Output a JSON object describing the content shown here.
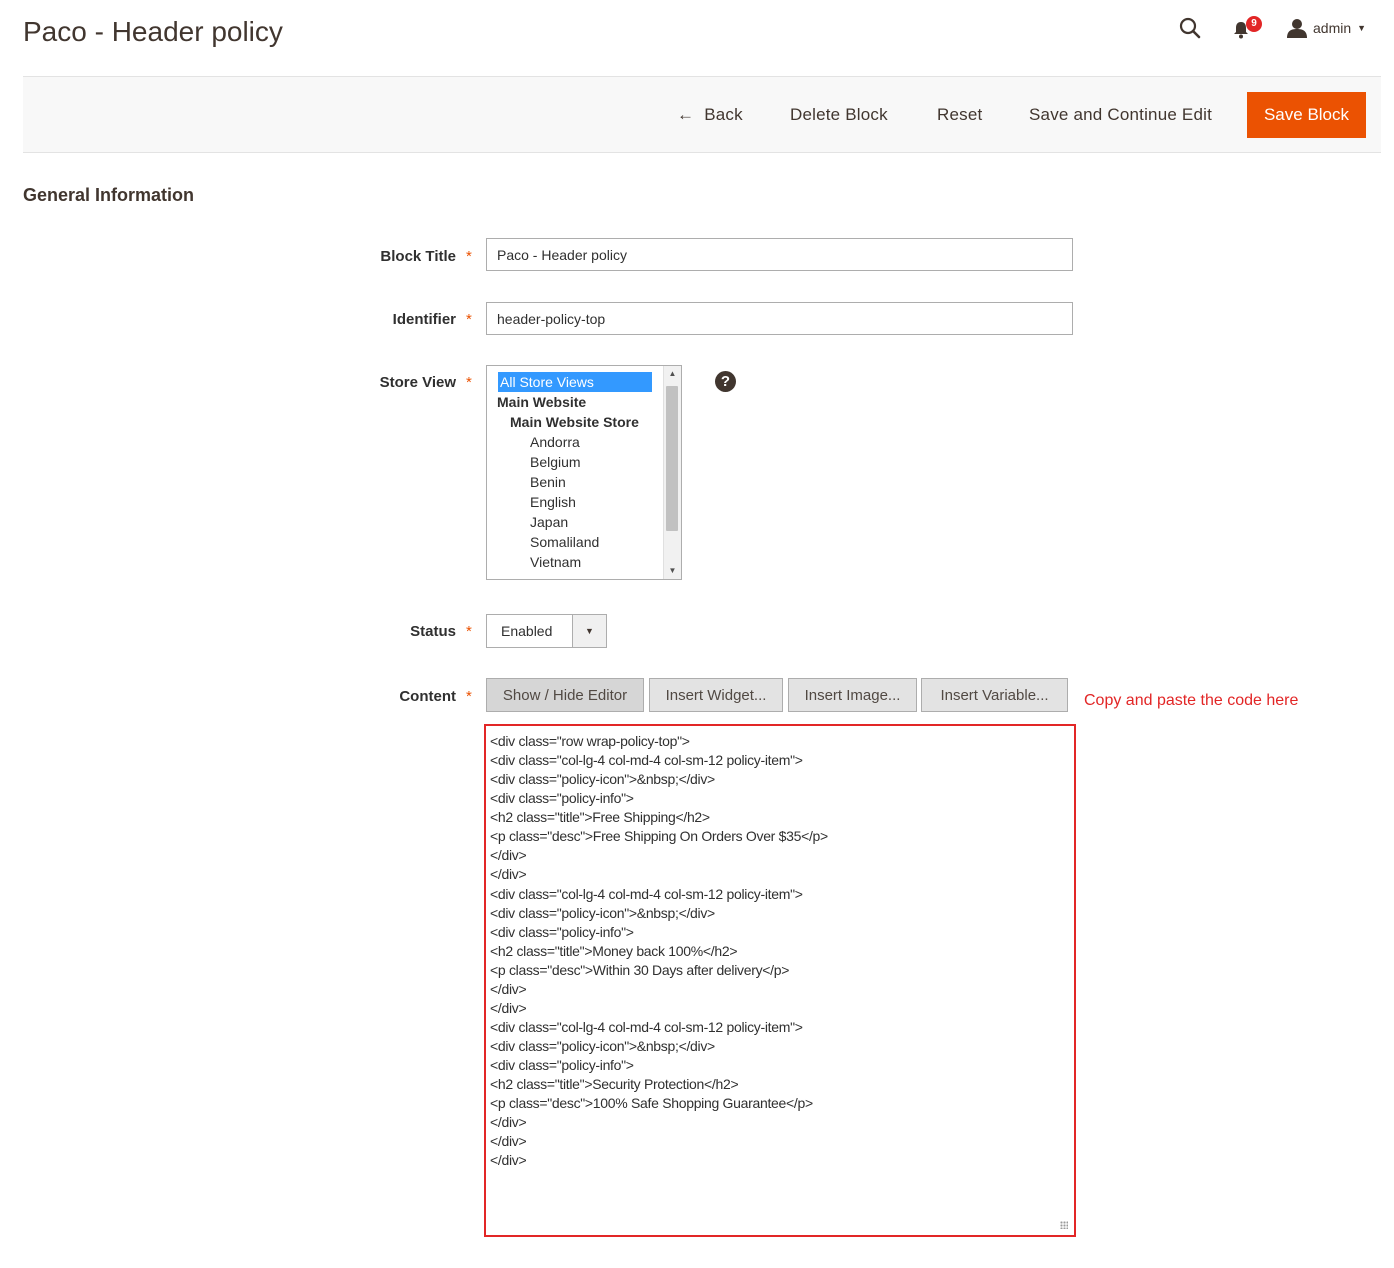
{
  "header": {
    "title": "Paco - Header policy",
    "notification_count": "9",
    "user": "admin"
  },
  "actions": {
    "back": "Back",
    "delete": "Delete Block",
    "reset": "Reset",
    "save_continue": "Save and Continue Edit",
    "save": "Save Block"
  },
  "section_title": "General Information",
  "form": {
    "block_title": {
      "label": "Block Title",
      "value": "Paco - Header policy"
    },
    "identifier": {
      "label": "Identifier",
      "value": "header-policy-top"
    },
    "store_view": {
      "label": "Store View",
      "options": [
        {
          "text": "All Store Views",
          "selected": true,
          "bold": false,
          "indent": 0
        },
        {
          "text": "Main Website",
          "selected": false,
          "bold": true,
          "indent": 0
        },
        {
          "text": "Main Website Store",
          "selected": false,
          "bold": true,
          "indent": 1
        },
        {
          "text": "Andorra",
          "selected": false,
          "bold": false,
          "indent": 2
        },
        {
          "text": "Belgium",
          "selected": false,
          "bold": false,
          "indent": 2
        },
        {
          "text": "Benin",
          "selected": false,
          "bold": false,
          "indent": 2
        },
        {
          "text": "English",
          "selected": false,
          "bold": false,
          "indent": 2
        },
        {
          "text": "Japan",
          "selected": false,
          "bold": false,
          "indent": 2
        },
        {
          "text": "Somaliland",
          "selected": false,
          "bold": false,
          "indent": 2
        },
        {
          "text": "Vietnam",
          "selected": false,
          "bold": false,
          "indent": 2
        }
      ]
    },
    "status": {
      "label": "Status",
      "value": "Enabled"
    },
    "content": {
      "label": "Content",
      "buttons": {
        "toggle": "Show / Hide Editor",
        "widget": "Insert Widget...",
        "image": "Insert Image...",
        "variable": "Insert Variable..."
      },
      "annotation": "Copy and paste the code here",
      "lines": [
        "<div class=\"row wrap-policy-top\">",
        "<div class=\"col-lg-4 col-md-4 col-sm-12 policy-item\">",
        "<div class=\"policy-icon\">&nbsp;</div>",
        "<div class=\"policy-info\">",
        "<h2 class=\"title\">Free Shipping</h2>",
        "<p class=\"desc\">Free Shipping On Orders Over $35</p>",
        "</div>",
        "</div>",
        "<div class=\"col-lg-4 col-md-4 col-sm-12 policy-item\">",
        "<div class=\"policy-icon\">&nbsp;</div>",
        "<div class=\"policy-info\">",
        "<h2 class=\"title\">Money back 100%</h2>",
        "<p class=\"desc\">Within 30 Days after delivery</p>",
        "</div>",
        "</div>",
        "<div class=\"col-lg-4 col-md-4 col-sm-12 policy-item\">",
        "<div class=\"policy-icon\">&nbsp;</div>",
        "<div class=\"policy-info\">",
        "<h2 class=\"title\">Security Protection</h2>",
        "<p class=\"desc\">100% Safe Shopping Guarantee</p>",
        "</div>",
        "</div>",
        "</div>"
      ]
    }
  },
  "colors": {
    "primary": "#eb5202",
    "required": "#eb5202",
    "annotation": "#e22626",
    "selected_option": "#3399ff"
  },
  "icons": [
    "search-icon",
    "bell-icon",
    "user-icon",
    "caret-down-icon",
    "arrow-left-icon",
    "help-icon"
  ]
}
